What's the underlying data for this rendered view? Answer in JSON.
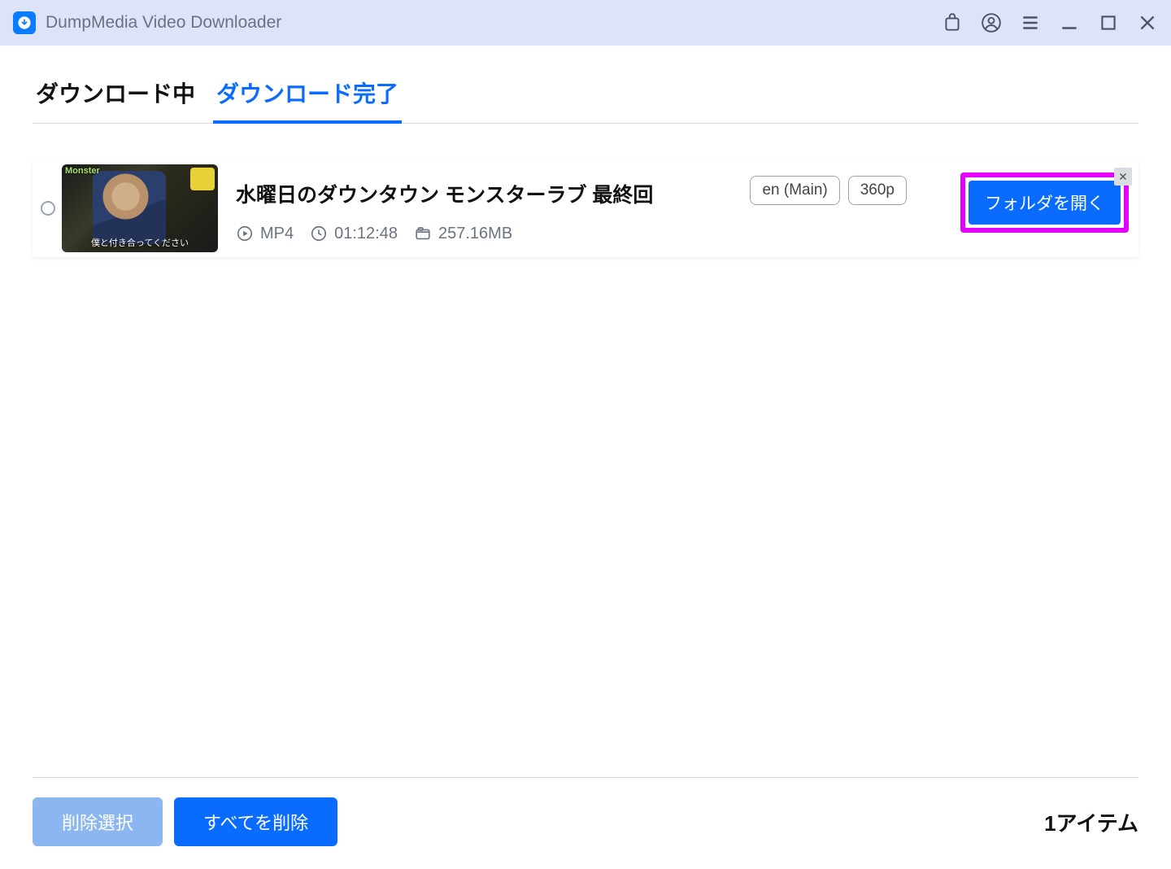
{
  "app": {
    "title": "DumpMedia Video Downloader"
  },
  "tabs": {
    "downloading": "ダウンロード中",
    "completed": "ダウンロード完了"
  },
  "item": {
    "title": "水曜日のダウンタウン モンスターラブ 最終回",
    "format": "MP4",
    "duration": "01:12:48",
    "size": "257.16MB",
    "lang_badge": "en (Main)",
    "quality_badge": "360p",
    "open_folder": "フォルダを開く",
    "thumb_topleft": "Monster",
    "thumb_caption": "僕と付き合ってください"
  },
  "footer": {
    "delete_selected": "削除選択",
    "delete_all": "すべてを削除",
    "count": "1アイテム"
  }
}
